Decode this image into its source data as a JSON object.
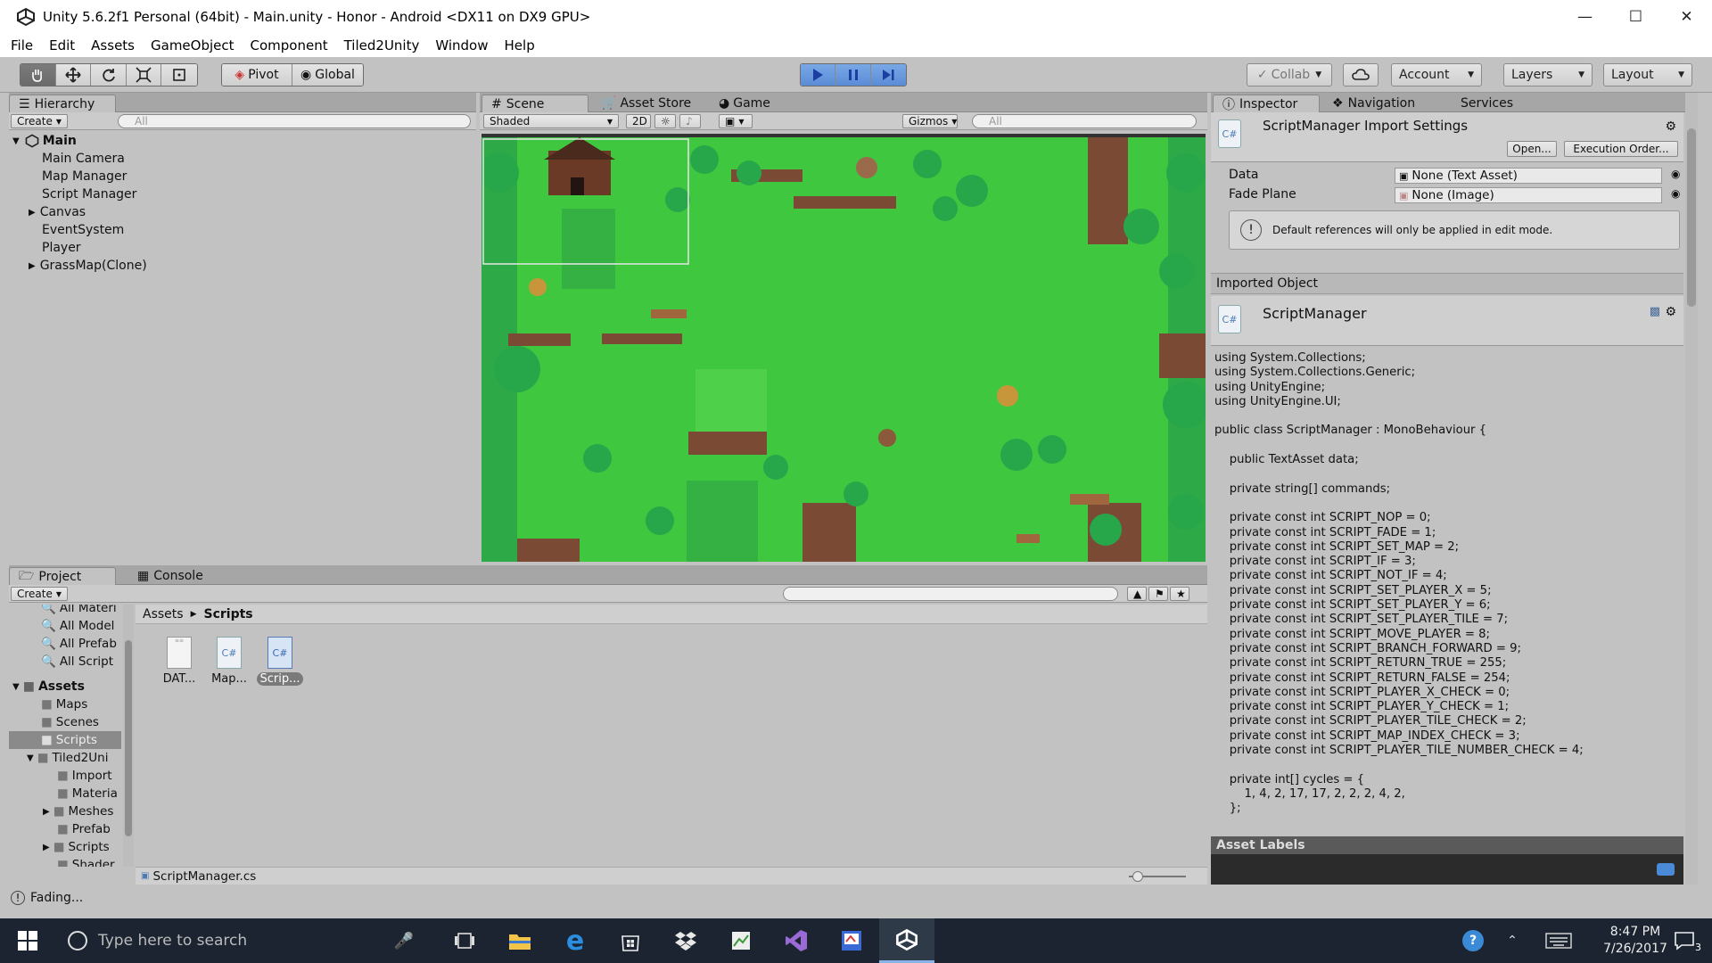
{
  "window": {
    "title": "Unity 5.6.2f1 Personal (64bit) - Main.unity - Honor - Android <DX11 on DX9 GPU>",
    "min": "—",
    "max": "☐",
    "close": "✕"
  },
  "menu": [
    "File",
    "Edit",
    "Assets",
    "GameObject",
    "Component",
    "Tiled2Unity",
    "Window",
    "Help"
  ],
  "toolbar": {
    "pivot": "Pivot",
    "global": "Global",
    "collab": "Collab",
    "account": "Account",
    "layers": "Layers",
    "layout": "Layout"
  },
  "hierarchy": {
    "tab": "Hierarchy",
    "create": "Create",
    "search_placeholder": "All",
    "scene": "Main",
    "items": [
      "Main Camera",
      "Map Manager",
      "Script Manager",
      "Canvas",
      "EventSystem",
      "Player",
      "GrassMap(Clone)"
    ]
  },
  "scene": {
    "tabs": [
      "Scene",
      "Asset Store",
      "Game"
    ],
    "shading": "Shaded",
    "mode2d": "2D",
    "gizmos": "Gizmos",
    "search_placeholder": "All"
  },
  "project": {
    "tabs": [
      "Project",
      "Console"
    ],
    "create": "Create",
    "favorites": [
      "All Materi",
      "All Model",
      "All Prefab",
      "All Script"
    ],
    "assets_label": "Assets",
    "tree": [
      "Maps",
      "Scenes",
      "Scripts",
      "Tiled2Uni",
      "Import",
      "Materia",
      "Meshes",
      "Prefab",
      "Scripts",
      "Shader"
    ],
    "breadcrumb": [
      "Assets",
      "Scripts"
    ],
    "files": [
      "DAT...",
      "Map...",
      "Scrip..."
    ],
    "selected_file": "ScriptManager.cs"
  },
  "status": "Fading...",
  "inspector": {
    "tabs": [
      "Inspector",
      "Navigation",
      "Services"
    ],
    "title": "ScriptManager Import Settings",
    "open_btn": "Open...",
    "exec_btn": "Execution Order...",
    "fields": [
      {
        "label": "Data",
        "value": "None (Text Asset)"
      },
      {
        "label": "Fade Plane",
        "value": "None (Image)"
      }
    ],
    "info": "Default references will only be applied in edit mode.",
    "imported_header": "Imported Object",
    "object_name": "ScriptManager",
    "asset_labels": "Asset Labels",
    "code": "using System.Collections;\nusing System.Collections.Generic;\nusing UnityEngine;\nusing UnityEngine.UI;\n\npublic class ScriptManager : MonoBehaviour {\n\n    public TextAsset data;\n\n    private string[] commands;\n\n    private const int SCRIPT_NOP = 0;\n    private const int SCRIPT_FADE = 1;\n    private const int SCRIPT_SET_MAP = 2;\n    private const int SCRIPT_IF = 3;\n    private const int SCRIPT_NOT_IF = 4;\n    private const int SCRIPT_SET_PLAYER_X = 5;\n    private const int SCRIPT_SET_PLAYER_Y = 6;\n    private const int SCRIPT_SET_PLAYER_TILE = 7;\n    private const int SCRIPT_MOVE_PLAYER = 8;\n    private const int SCRIPT_BRANCH_FORWARD = 9;\n    private const int SCRIPT_RETURN_TRUE = 255;\n    private const int SCRIPT_RETURN_FALSE = 254;\n    private const int SCRIPT_PLAYER_X_CHECK = 0;\n    private const int SCRIPT_PLAYER_Y_CHECK = 1;\n    private const int SCRIPT_PLAYER_TILE_CHECK = 2;\n    private const int SCRIPT_MAP_INDEX_CHECK = 3;\n    private const int SCRIPT_PLAYER_TILE_NUMBER_CHECK = 4;\n\n    private int[] cycles = {\n        1, 4, 2, 17, 17, 2, 2, 2, 4, 2,\n    };"
  },
  "taskbar": {
    "search_placeholder": "Type here to search",
    "time": "8:47 PM",
    "date": "7/26/2017",
    "notif": "3"
  },
  "colors": {
    "grass": "#3fc83f",
    "dark_grass": "#2fa33a",
    "tree": "#28a64a",
    "dirt": "#7a4a34",
    "play_blue": "#5a8cd6"
  }
}
